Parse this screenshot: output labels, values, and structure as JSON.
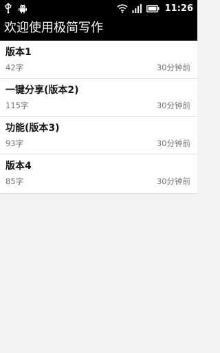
{
  "status_bar": {
    "time": "11:26",
    "icons": [
      "usb-icon",
      "android-icon",
      "wifi-icon",
      "signal-icon",
      "battery-icon"
    ]
  },
  "header": {
    "title": "欢迎使用极简写作"
  },
  "notes": [
    {
      "title": "版本1",
      "count": "42字",
      "time": "30分钟前"
    },
    {
      "title": "一键分享(版本2)",
      "count": "115字",
      "time": "30分钟前"
    },
    {
      "title": "功能(版本3)",
      "count": "93字",
      "time": "30分钟前"
    },
    {
      "title": "版本4",
      "count": "85字",
      "time": "30分钟前"
    }
  ],
  "colors": {
    "bar_background": "#000000",
    "list_background": "#ffffff",
    "page_background": "#f2f2f2",
    "secondary_text": "#777777"
  }
}
